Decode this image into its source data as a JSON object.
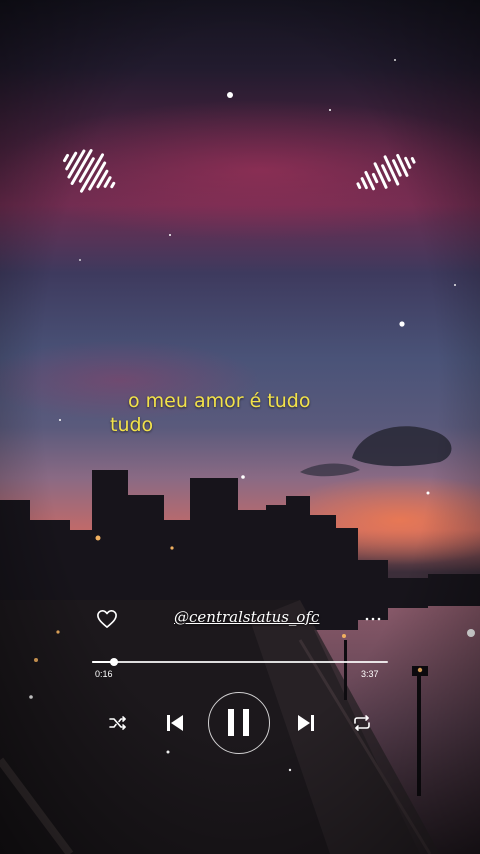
{
  "lyrics": {
    "line1": "o meu amor é tudo",
    "line2": "tudo"
  },
  "player": {
    "handle": "@centralstatus_ofc",
    "time_elapsed": "0:16",
    "time_total": "3:37",
    "progress": 0.074,
    "state": "playing",
    "controls": [
      "shuffle-icon",
      "previous-icon",
      "pause-icon",
      "next-icon",
      "repeat-icon"
    ]
  },
  "icons": {
    "like": "heart-icon",
    "more": "more-options-icon",
    "sound_wave": "sound-wave-icon"
  },
  "colors": {
    "lyric": "#f2e24a",
    "controls": "#ffffff",
    "sky_top": "#1c1a2c",
    "sky_pink": "#7a2f55",
    "horizon_glow": "#d9604a",
    "water": "#6a4a5a"
  }
}
